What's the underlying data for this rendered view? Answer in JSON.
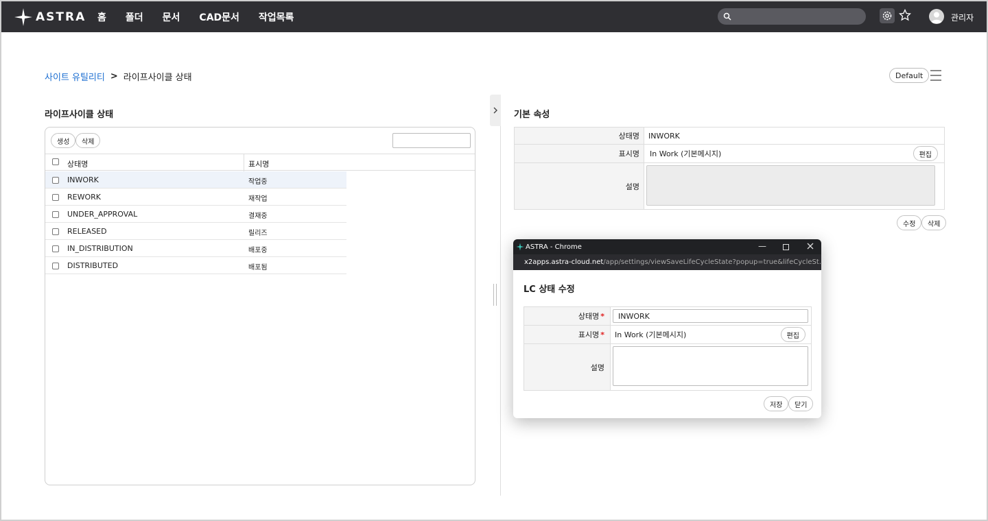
{
  "header": {
    "logo_text": "ASTRA",
    "nav": [
      "홈",
      "폴더",
      "문서",
      "CAD문서",
      "작업목록"
    ],
    "user": "관리자"
  },
  "breadcrumb": {
    "parent": "사이트 유틸리티",
    "separator": ">",
    "current": "라이프사이클 상태"
  },
  "toolbar": {
    "default_label": "Default"
  },
  "left": {
    "title": "라이프사이클 상태",
    "create_label": "생성",
    "delete_label": "삭제",
    "columns": {
      "name": "상태명",
      "display": "표시명"
    },
    "rows": [
      {
        "name": "INWORK",
        "display": "작업중"
      },
      {
        "name": "REWORK",
        "display": "재작업"
      },
      {
        "name": "UNDER_APPROVAL",
        "display": "결재중"
      },
      {
        "name": "RELEASED",
        "display": "릴리즈"
      },
      {
        "name": "IN_DISTRIBUTION",
        "display": "배포중"
      },
      {
        "name": "DISTRIBUTED",
        "display": "배포됨"
      }
    ]
  },
  "right": {
    "title": "기본 속성",
    "state_label": "상태명",
    "state_value": "INWORK",
    "display_label": "표시명",
    "display_value": "In Work (기본메시지)",
    "edit_label": "편집",
    "desc_label": "설명",
    "modify_label": "수정",
    "delete_label": "삭제"
  },
  "popup": {
    "window_title": "ASTRA - Chrome",
    "url_host": "x2apps.astra-cloud.net",
    "url_path": "/app/settings/viewSaveLifeCycleState?popup=true&lifeCycleSt...",
    "heading": "LC 상태 수정",
    "state_label": "상태명",
    "state_value": "INWORK",
    "display_label": "표시명",
    "display_value": "In Work (기본메시지)",
    "edit_label": "편집",
    "desc_label": "설명",
    "required_mark": "*",
    "save_label": "저장",
    "close_label": "닫기"
  },
  "colors": {
    "topbar": "#2f2f33",
    "link": "#1c6ed1",
    "required": "#e02020",
    "selected_row": "#eef3fa"
  }
}
